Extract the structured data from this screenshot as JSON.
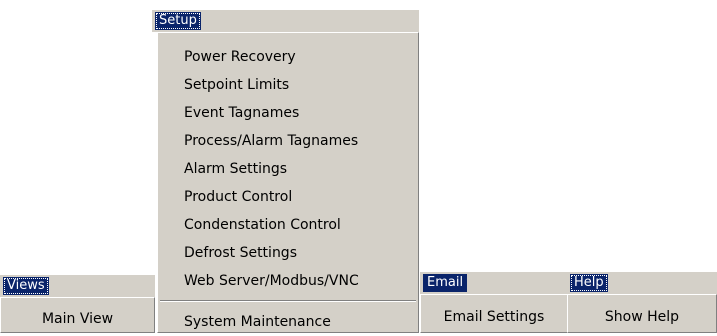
{
  "setup_menu": {
    "title": "Setup",
    "items": [
      "Power Recovery",
      "Setpoint Limits",
      "Event Tagnames",
      "Process/Alarm Tagnames",
      "Alarm Settings",
      "Product Control",
      "Condenstation Control",
      "Defrost Settings",
      "Web Server/Modbus/VNC"
    ],
    "after_separator": "System Maintenance"
  },
  "views_menu": {
    "title": "Views",
    "items": [
      "Main View"
    ]
  },
  "email_menu": {
    "title": "Email",
    "items": [
      "Email Settings"
    ]
  },
  "help_menu": {
    "title": "Help",
    "items": [
      "Show Help"
    ]
  },
  "colors": {
    "menu_background": "#d4d0c8",
    "highlight": "#0a246a",
    "highlight_text": "#ffffff"
  }
}
